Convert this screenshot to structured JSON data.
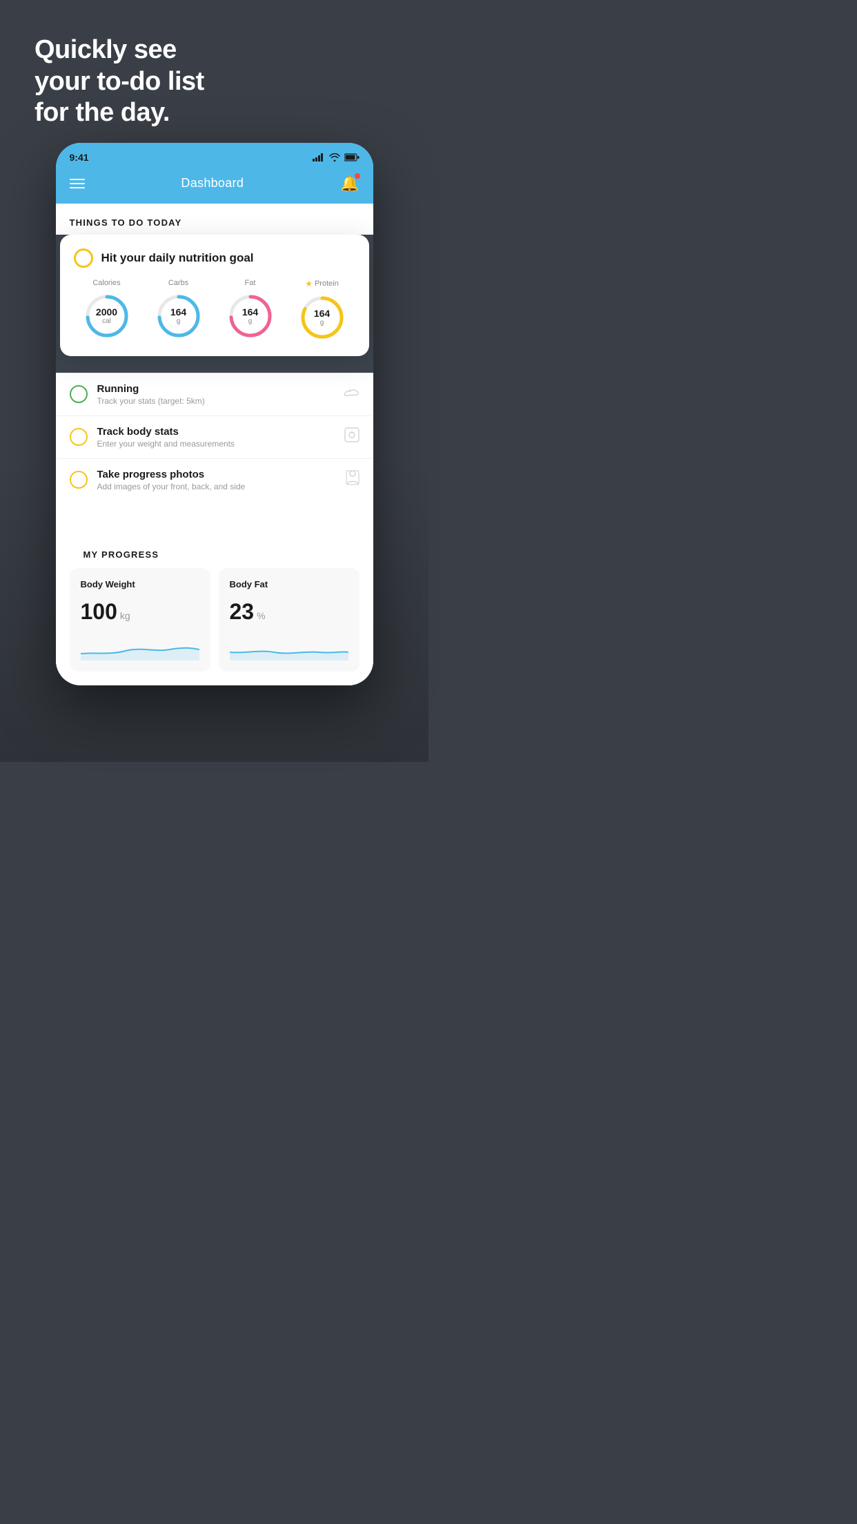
{
  "hero": {
    "title_line1": "Quickly see",
    "title_line2": "your to-do list",
    "title_line3": "for the day."
  },
  "status_bar": {
    "time": "9:41",
    "signal": "▌▌▌▌",
    "wifi": "wifi",
    "battery": "battery"
  },
  "header": {
    "title": "Dashboard"
  },
  "things_section": {
    "title": "THINGS TO DO TODAY"
  },
  "nutrition_card": {
    "title": "Hit your daily nutrition goal",
    "items": [
      {
        "label": "Calories",
        "value": "2000",
        "unit": "cal",
        "color": "blue",
        "starred": false
      },
      {
        "label": "Carbs",
        "value": "164",
        "unit": "g",
        "color": "blue",
        "starred": false
      },
      {
        "label": "Fat",
        "value": "164",
        "unit": "g",
        "color": "pink",
        "starred": false
      },
      {
        "label": "Protein",
        "value": "164",
        "unit": "g",
        "color": "yellow",
        "starred": true
      }
    ]
  },
  "todo_items": [
    {
      "id": "running",
      "title": "Running",
      "subtitle": "Track your stats (target: 5km)",
      "circle_color": "green",
      "icon": "shoe"
    },
    {
      "id": "body-stats",
      "title": "Track body stats",
      "subtitle": "Enter your weight and measurements",
      "circle_color": "yellow",
      "icon": "scale"
    },
    {
      "id": "progress-photos",
      "title": "Take progress photos",
      "subtitle": "Add images of your front, back, and side",
      "circle_color": "yellow",
      "icon": "person"
    }
  ],
  "progress_section": {
    "title": "MY PROGRESS",
    "cards": [
      {
        "title": "Body Weight",
        "value": "100",
        "unit": "kg"
      },
      {
        "title": "Body Fat",
        "value": "23",
        "unit": "%"
      }
    ]
  }
}
